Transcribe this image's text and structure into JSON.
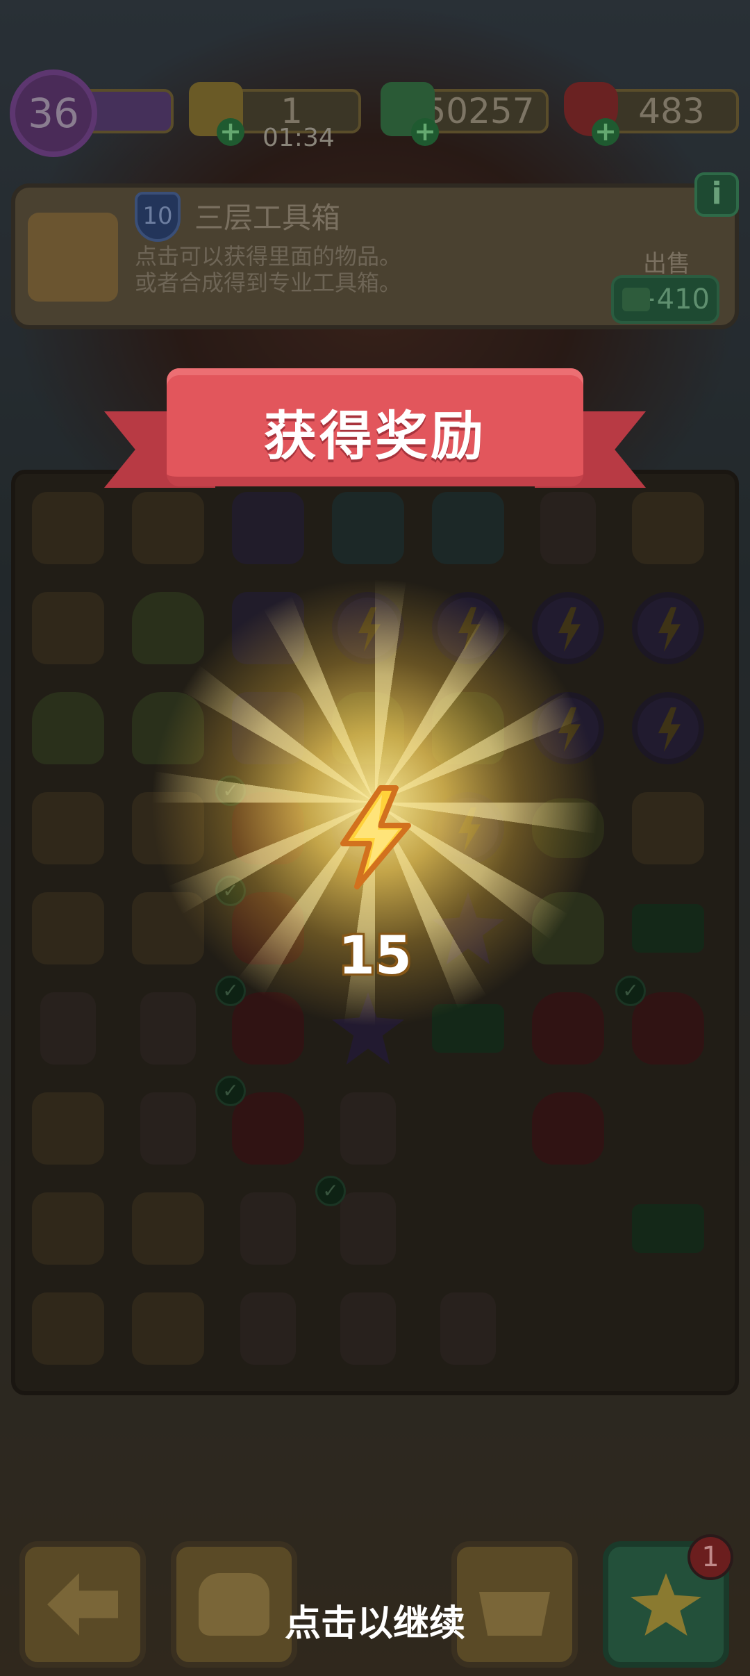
{
  "hud": {
    "level": "36",
    "energy": {
      "value": "1",
      "timer": "01:34"
    },
    "cash": "50257",
    "gems": "483"
  },
  "info_panel": {
    "item_level": "10",
    "item_name": "三层工具箱",
    "description_line1": "点击可以获得里面的物品。",
    "description_line2": "或者合成得到专业工具箱。",
    "sell_label": "出售",
    "sell_value": "+410",
    "info_button": "i"
  },
  "reward": {
    "banner": "获得奖励",
    "icon": "energy-bolt-icon",
    "count": "15"
  },
  "bottom_bar": {
    "continue_hint": "点击以继续",
    "star_badge": "1",
    "buttons": [
      "back-arrow-icon",
      "backpack-icon",
      "basket-icon",
      "star-icon"
    ]
  },
  "board": {
    "rows": [
      [
        "box",
        "box",
        "car",
        "jar",
        "jar",
        "tool",
        "box"
      ],
      [
        "box",
        "plant",
        "car",
        "energy",
        "energy",
        "energy",
        "energy"
      ],
      [
        "plant",
        "plant",
        "car",
        "plant",
        "plant",
        "energy",
        "energy"
      ],
      [
        "box",
        "box",
        "glove",
        "energy",
        "energy",
        "soap",
        "box"
      ],
      [
        "box",
        "box",
        "glove",
        "",
        "star",
        "plant",
        "cash"
      ],
      [
        "tool",
        "tool",
        "glove",
        "star",
        "cash",
        "glove",
        "glove"
      ],
      [
        "box",
        "tool",
        "glove",
        "tool",
        "",
        "glove",
        ""
      ],
      [
        "box",
        "box",
        "tool",
        "tool",
        "",
        "",
        "cash"
      ],
      [
        "box",
        "box",
        "tool",
        "tool",
        "tool",
        "",
        ""
      ]
    ],
    "checked_cells": [
      "3-2",
      "4-2",
      "5-2",
      "5-6",
      "6-2",
      "7-3"
    ]
  },
  "colors": {
    "ribbon": "#e2565c",
    "reward_glow": "#ffeea0",
    "text_white": "#ffffff"
  }
}
